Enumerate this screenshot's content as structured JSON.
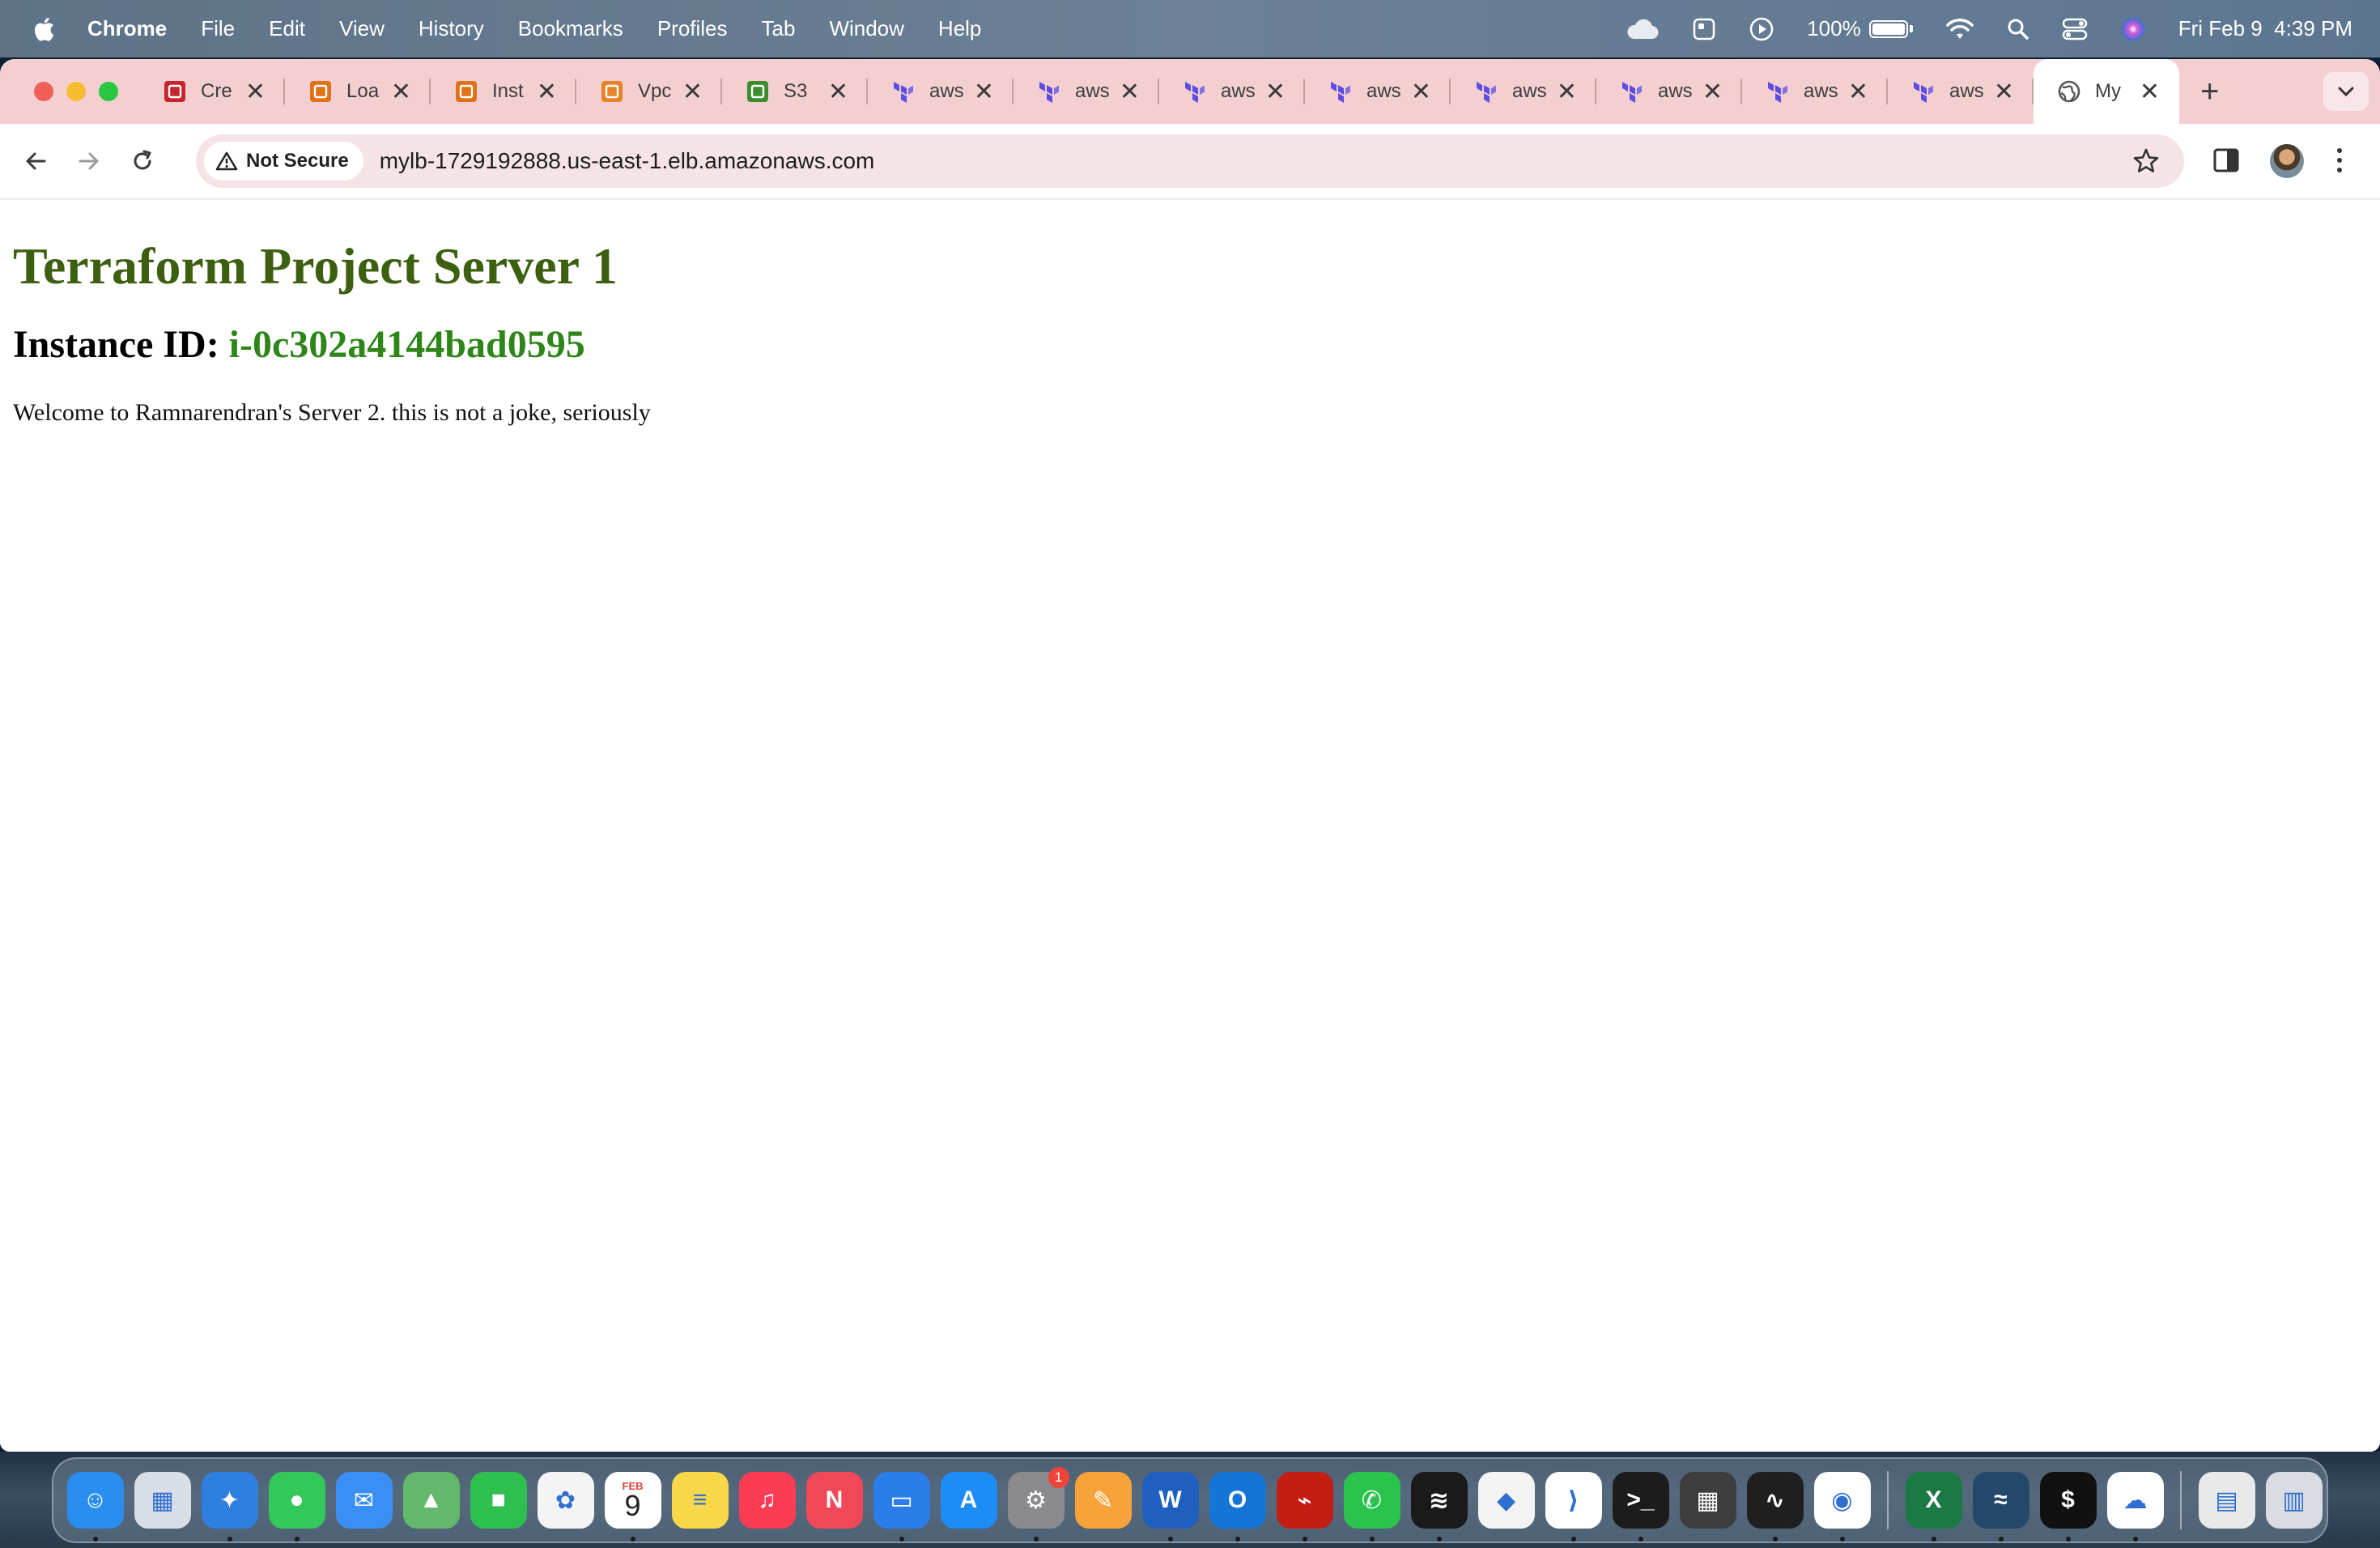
{
  "menubar": {
    "app_name": "Chrome",
    "menus": [
      "File",
      "Edit",
      "View",
      "History",
      "Bookmarks",
      "Profiles",
      "Tab",
      "Window",
      "Help"
    ],
    "battery_percent": "100%",
    "battery_level": 1.0,
    "date": "Fri Feb 9",
    "time": "4:39 PM"
  },
  "tabs": [
    {
      "title": "Cre",
      "icon": "aws-certificate-icon",
      "color": "#c7252d"
    },
    {
      "title": "Loa",
      "icon": "aws-ec2-icon",
      "color": "#e07116"
    },
    {
      "title": "Inst",
      "icon": "aws-ec2-icon",
      "color": "#e07116"
    },
    {
      "title": "Vpc",
      "icon": "aws-vpc-icon",
      "color": "#e8832a"
    },
    {
      "title": "S3",
      "icon": "aws-s3-icon",
      "color": "#3c8c2c"
    },
    {
      "title": "aws",
      "icon": "terraform-icon",
      "color": "#5c4ee5"
    },
    {
      "title": "aws",
      "icon": "terraform-icon",
      "color": "#5c4ee5"
    },
    {
      "title": "aws",
      "icon": "terraform-icon",
      "color": "#5c4ee5"
    },
    {
      "title": "aws",
      "icon": "terraform-icon",
      "color": "#5c4ee5"
    },
    {
      "title": "aws",
      "icon": "terraform-icon",
      "color": "#5c4ee5"
    },
    {
      "title": "aws",
      "icon": "terraform-icon",
      "color": "#5c4ee5"
    },
    {
      "title": "aws",
      "icon": "terraform-icon",
      "color": "#5c4ee5"
    },
    {
      "title": "aws",
      "icon": "terraform-icon",
      "color": "#5c4ee5"
    },
    {
      "title": "My",
      "icon": "globe-icon",
      "color": "#555555",
      "active": true
    }
  ],
  "toolbar": {
    "security_label": "Not Secure",
    "url": "mylb-1729192888.us-east-1.elb.amazonaws.com"
  },
  "page": {
    "heading": "Terraform Project Server 1",
    "instance_label": "Instance ID:",
    "instance_id": "i-0c302a4144bad0595",
    "message": "Welcome to Ramnarendran's Server 2. this is not a joke, seriously"
  },
  "dock": {
    "calendar_month": "FEB",
    "calendar_day": "9",
    "settings_badge": "1",
    "apps": [
      {
        "name": "finder",
        "color": "#2a8df0"
      },
      {
        "name": "launchpad",
        "color": "#d8dde6"
      },
      {
        "name": "safari",
        "color": "#2f7fe0"
      },
      {
        "name": "messages",
        "color": "#34c759"
      },
      {
        "name": "mail",
        "color": "#3b8ef3"
      },
      {
        "name": "maps",
        "color": "#63b86b"
      },
      {
        "name": "facetime",
        "color": "#2fbf4f"
      },
      {
        "name": "photos",
        "color": "#f4f4f4"
      },
      {
        "name": "calendar",
        "color": "#ffffff"
      },
      {
        "name": "notes",
        "color": "#f8d74a"
      },
      {
        "name": "music",
        "color": "#fa3c55"
      },
      {
        "name": "news",
        "color": "#f04858"
      },
      {
        "name": "keynote",
        "color": "#2b7de9"
      },
      {
        "name": "app-store",
        "color": "#1e8cf5"
      },
      {
        "name": "system-settings",
        "color": "#8a8a8f"
      },
      {
        "name": "pages",
        "color": "#f7a33a"
      },
      {
        "name": "word",
        "color": "#1f5fbf"
      },
      {
        "name": "outlook",
        "color": "#1475d6"
      },
      {
        "name": "acrobat",
        "color": "#c41e14"
      },
      {
        "name": "whatsapp",
        "color": "#29c34d"
      },
      {
        "name": "spotify",
        "color": "#1a1a1a"
      },
      {
        "name": "brave",
        "color": "#f3f3f3"
      },
      {
        "name": "vscode",
        "color": "#ffffff"
      },
      {
        "name": "terminal",
        "color": "#1c1c1c"
      },
      {
        "name": "calculator",
        "color": "#3d3d3d"
      },
      {
        "name": "activity-monitor",
        "color": "#1f1f1f"
      },
      {
        "name": "chrome",
        "color": "#ffffff"
      },
      {
        "name": "excel",
        "color": "#1b7a43"
      },
      {
        "name": "mysql-workbench",
        "color": "#24486b"
      },
      {
        "name": "iterm",
        "color": "#111111"
      },
      {
        "name": "onedrive",
        "color": "#ffffff"
      },
      {
        "name": "documents-stack",
        "color": "#e9e9e9"
      },
      {
        "name": "trash",
        "color": "#d9dde3"
      }
    ]
  }
}
